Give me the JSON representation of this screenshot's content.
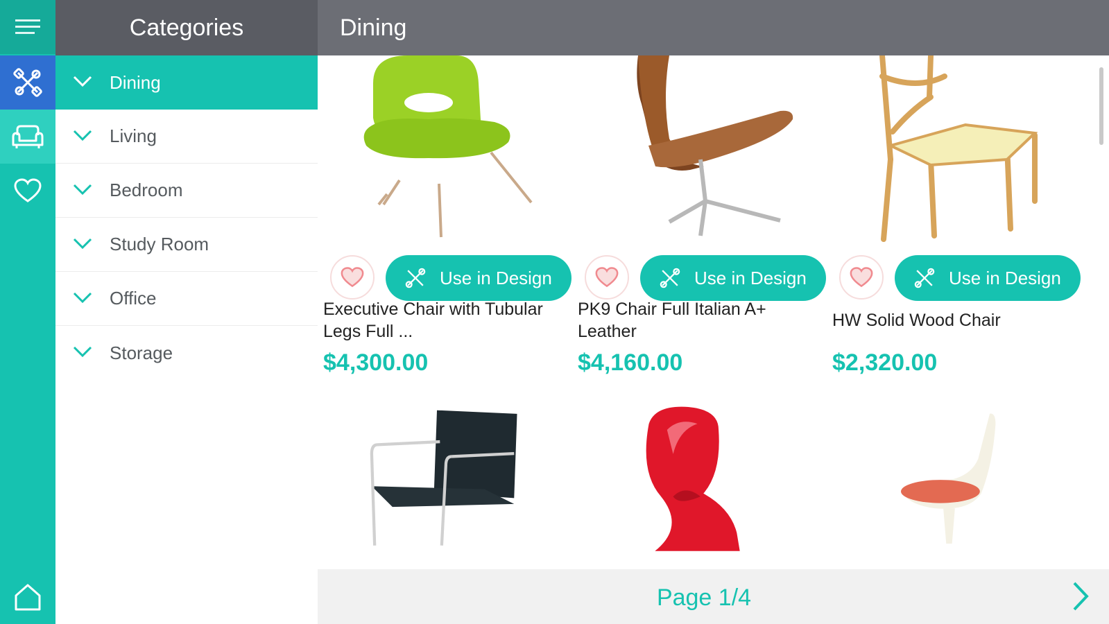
{
  "header": {
    "categories_title": "Categories",
    "section_title": "Dining"
  },
  "sidebar": {
    "rail": [
      "menu-icon",
      "design-tools-icon",
      "sofa-icon",
      "heart-icon",
      "home-icon"
    ],
    "categories": [
      {
        "label": "Dining",
        "active": true
      },
      {
        "label": "Living",
        "active": false
      },
      {
        "label": "Bedroom",
        "active": false
      },
      {
        "label": "Study Room",
        "active": false
      },
      {
        "label": "Office",
        "active": false
      },
      {
        "label": "Storage",
        "active": false
      }
    ]
  },
  "products": [
    {
      "name": "Executive Chair with Tubular Legs Full ...",
      "price": "$4,300.00",
      "button": "Use in Design",
      "image": "green-chair"
    },
    {
      "name": "PK9 Chair Full Italian A+ Leather",
      "price": "$4,160.00",
      "button": "Use in Design",
      "image": "brown-leather-chair"
    },
    {
      "name": "HW Solid Wood Chair",
      "price": "$2,320.00",
      "button": "Use in Design",
      "image": "wood-chair"
    },
    {
      "name": "",
      "price": "",
      "button": "",
      "image": "black-cantilever-chair"
    },
    {
      "name": "",
      "price": "",
      "button": "",
      "image": "red-panton-chair"
    },
    {
      "name": "",
      "price": "",
      "button": "",
      "image": "tulip-chair"
    }
  ],
  "pager": {
    "label": "Page 1/4"
  },
  "colors": {
    "accent": "#16c2b0",
    "header": "#6c6e75",
    "header_dark": "#5a5c63",
    "favorite": "#f08a8f"
  }
}
